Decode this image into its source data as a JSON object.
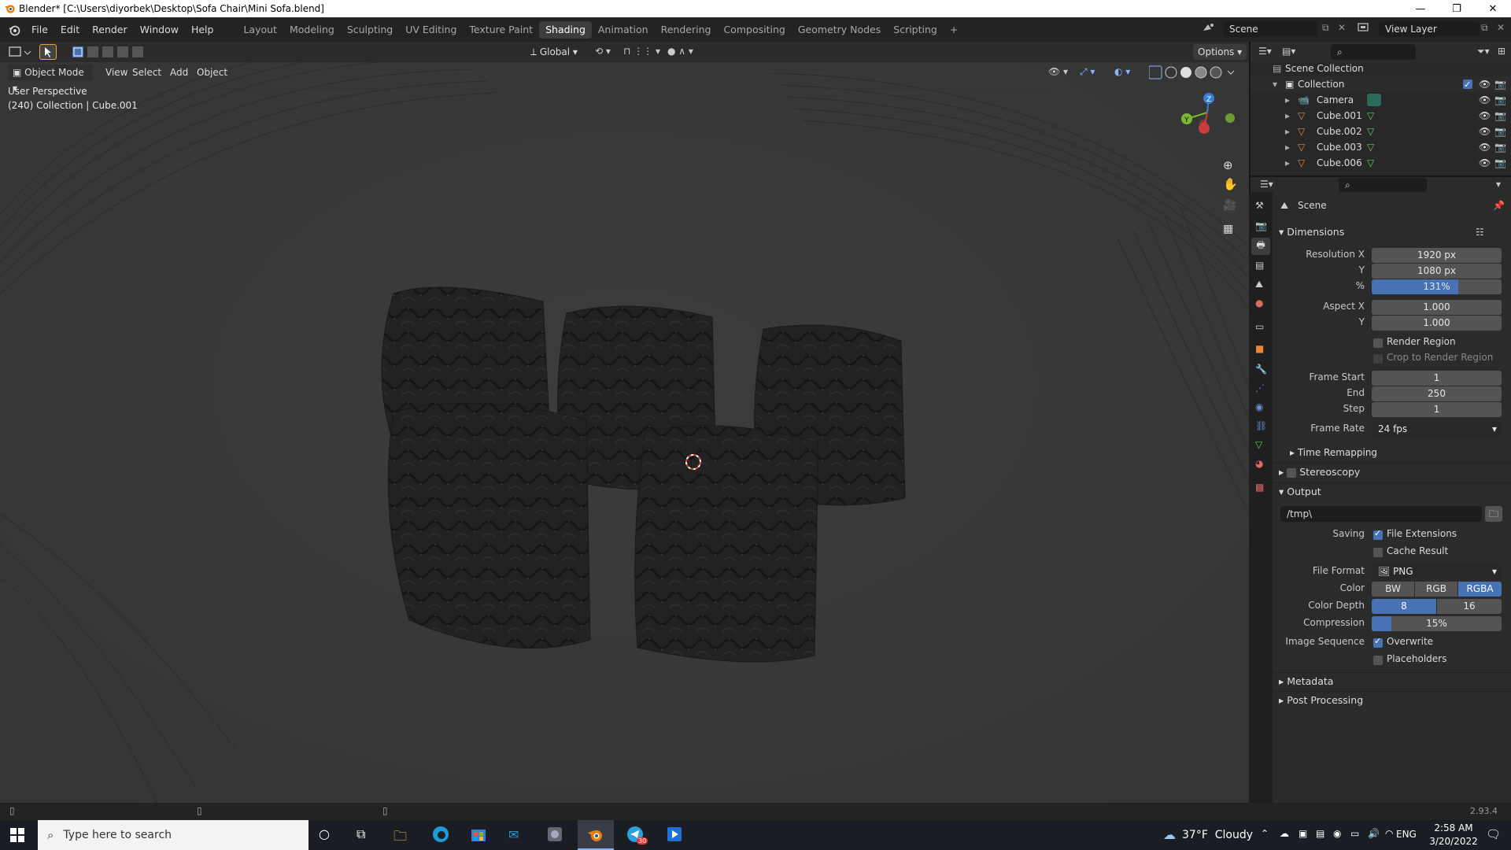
{
  "window": {
    "title": "Blender* [C:\\Users\\diyorbek\\Desktop\\Sofa Chair\\Mini Sofa.blend]",
    "minimize": "—",
    "maximize": "❐",
    "close": "✕"
  },
  "menu": [
    "File",
    "Edit",
    "Render",
    "Window",
    "Help"
  ],
  "workspaces": [
    "Layout",
    "Modeling",
    "Sculpting",
    "UV Editing",
    "Texture Paint",
    "Shading",
    "Animation",
    "Rendering",
    "Compositing",
    "Geometry Nodes",
    "Scripting"
  ],
  "active_workspace": "Shading",
  "scene_name": "Scene",
  "view_layer": "View Layer",
  "viewport": {
    "mode": "Object Mode",
    "menus": [
      "View",
      "Select",
      "Add",
      "Object"
    ],
    "orientation": "Global",
    "options_label": "Options",
    "perspective": "User Perspective",
    "collection_info": "(240) Collection | Cube.001"
  },
  "outliner": {
    "root": "Scene Collection",
    "collection": "Collection",
    "items": [
      "Camera",
      "Cube.001",
      "Cube.002",
      "Cube.003",
      "Cube.006"
    ]
  },
  "properties": {
    "context": "Scene",
    "dimensions_header": "Dimensions",
    "resolution_x_label": "Resolution X",
    "resolution_x": "1920 px",
    "y_label": "Y",
    "resolution_y": "1080 px",
    "pct_label": "%",
    "resolution_pct": "131%",
    "aspect_x_label": "Aspect X",
    "aspect_x": "1.000",
    "aspect_y": "1.000",
    "render_region": "Render Region",
    "crop_region": "Crop to Render Region",
    "frame_start_label": "Frame Start",
    "frame_start": "1",
    "end_label": "End",
    "frame_end": "250",
    "step_label": "Step",
    "frame_step": "1",
    "frame_rate_label": "Frame Rate",
    "frame_rate": "24 fps",
    "time_remapping": "Time Remapping",
    "stereoscopy": "Stereoscopy",
    "output_header": "Output",
    "output_path": "/tmp\\",
    "saving_label": "Saving",
    "file_extensions": "File Extensions",
    "cache_result": "Cache Result",
    "file_format_label": "File Format",
    "file_format": "PNG",
    "color_label": "Color",
    "color_options": [
      "BW",
      "RGB",
      "RGBA"
    ],
    "color_selected": "RGBA",
    "color_depth_label": "Color Depth",
    "color_depth_options": [
      "8",
      "16"
    ],
    "color_depth_selected": "8",
    "compression_label": "Compression",
    "compression": "15%",
    "compression_value": 0.15,
    "image_sequence_label": "Image Sequence",
    "overwrite": "Overwrite",
    "placeholders": "Placeholders",
    "metadata": "Metadata",
    "post_processing": "Post Processing"
  },
  "status": {
    "version": "2.93.4"
  },
  "taskbar": {
    "search_placeholder": "Type here to search",
    "weather": "37°F  Cloudy",
    "lang": "ENG",
    "time": "2:58 AM",
    "date": "3/20/2022",
    "telegram_badge": "30"
  },
  "colors": {
    "accent": "#4772b3",
    "active_tab": "#3d3d3d",
    "panel": "#2b2b2b",
    "viewport_bg": "#3d3d3d",
    "object_orange": "#e8863a",
    "mesh_green": "#6ec06e"
  }
}
